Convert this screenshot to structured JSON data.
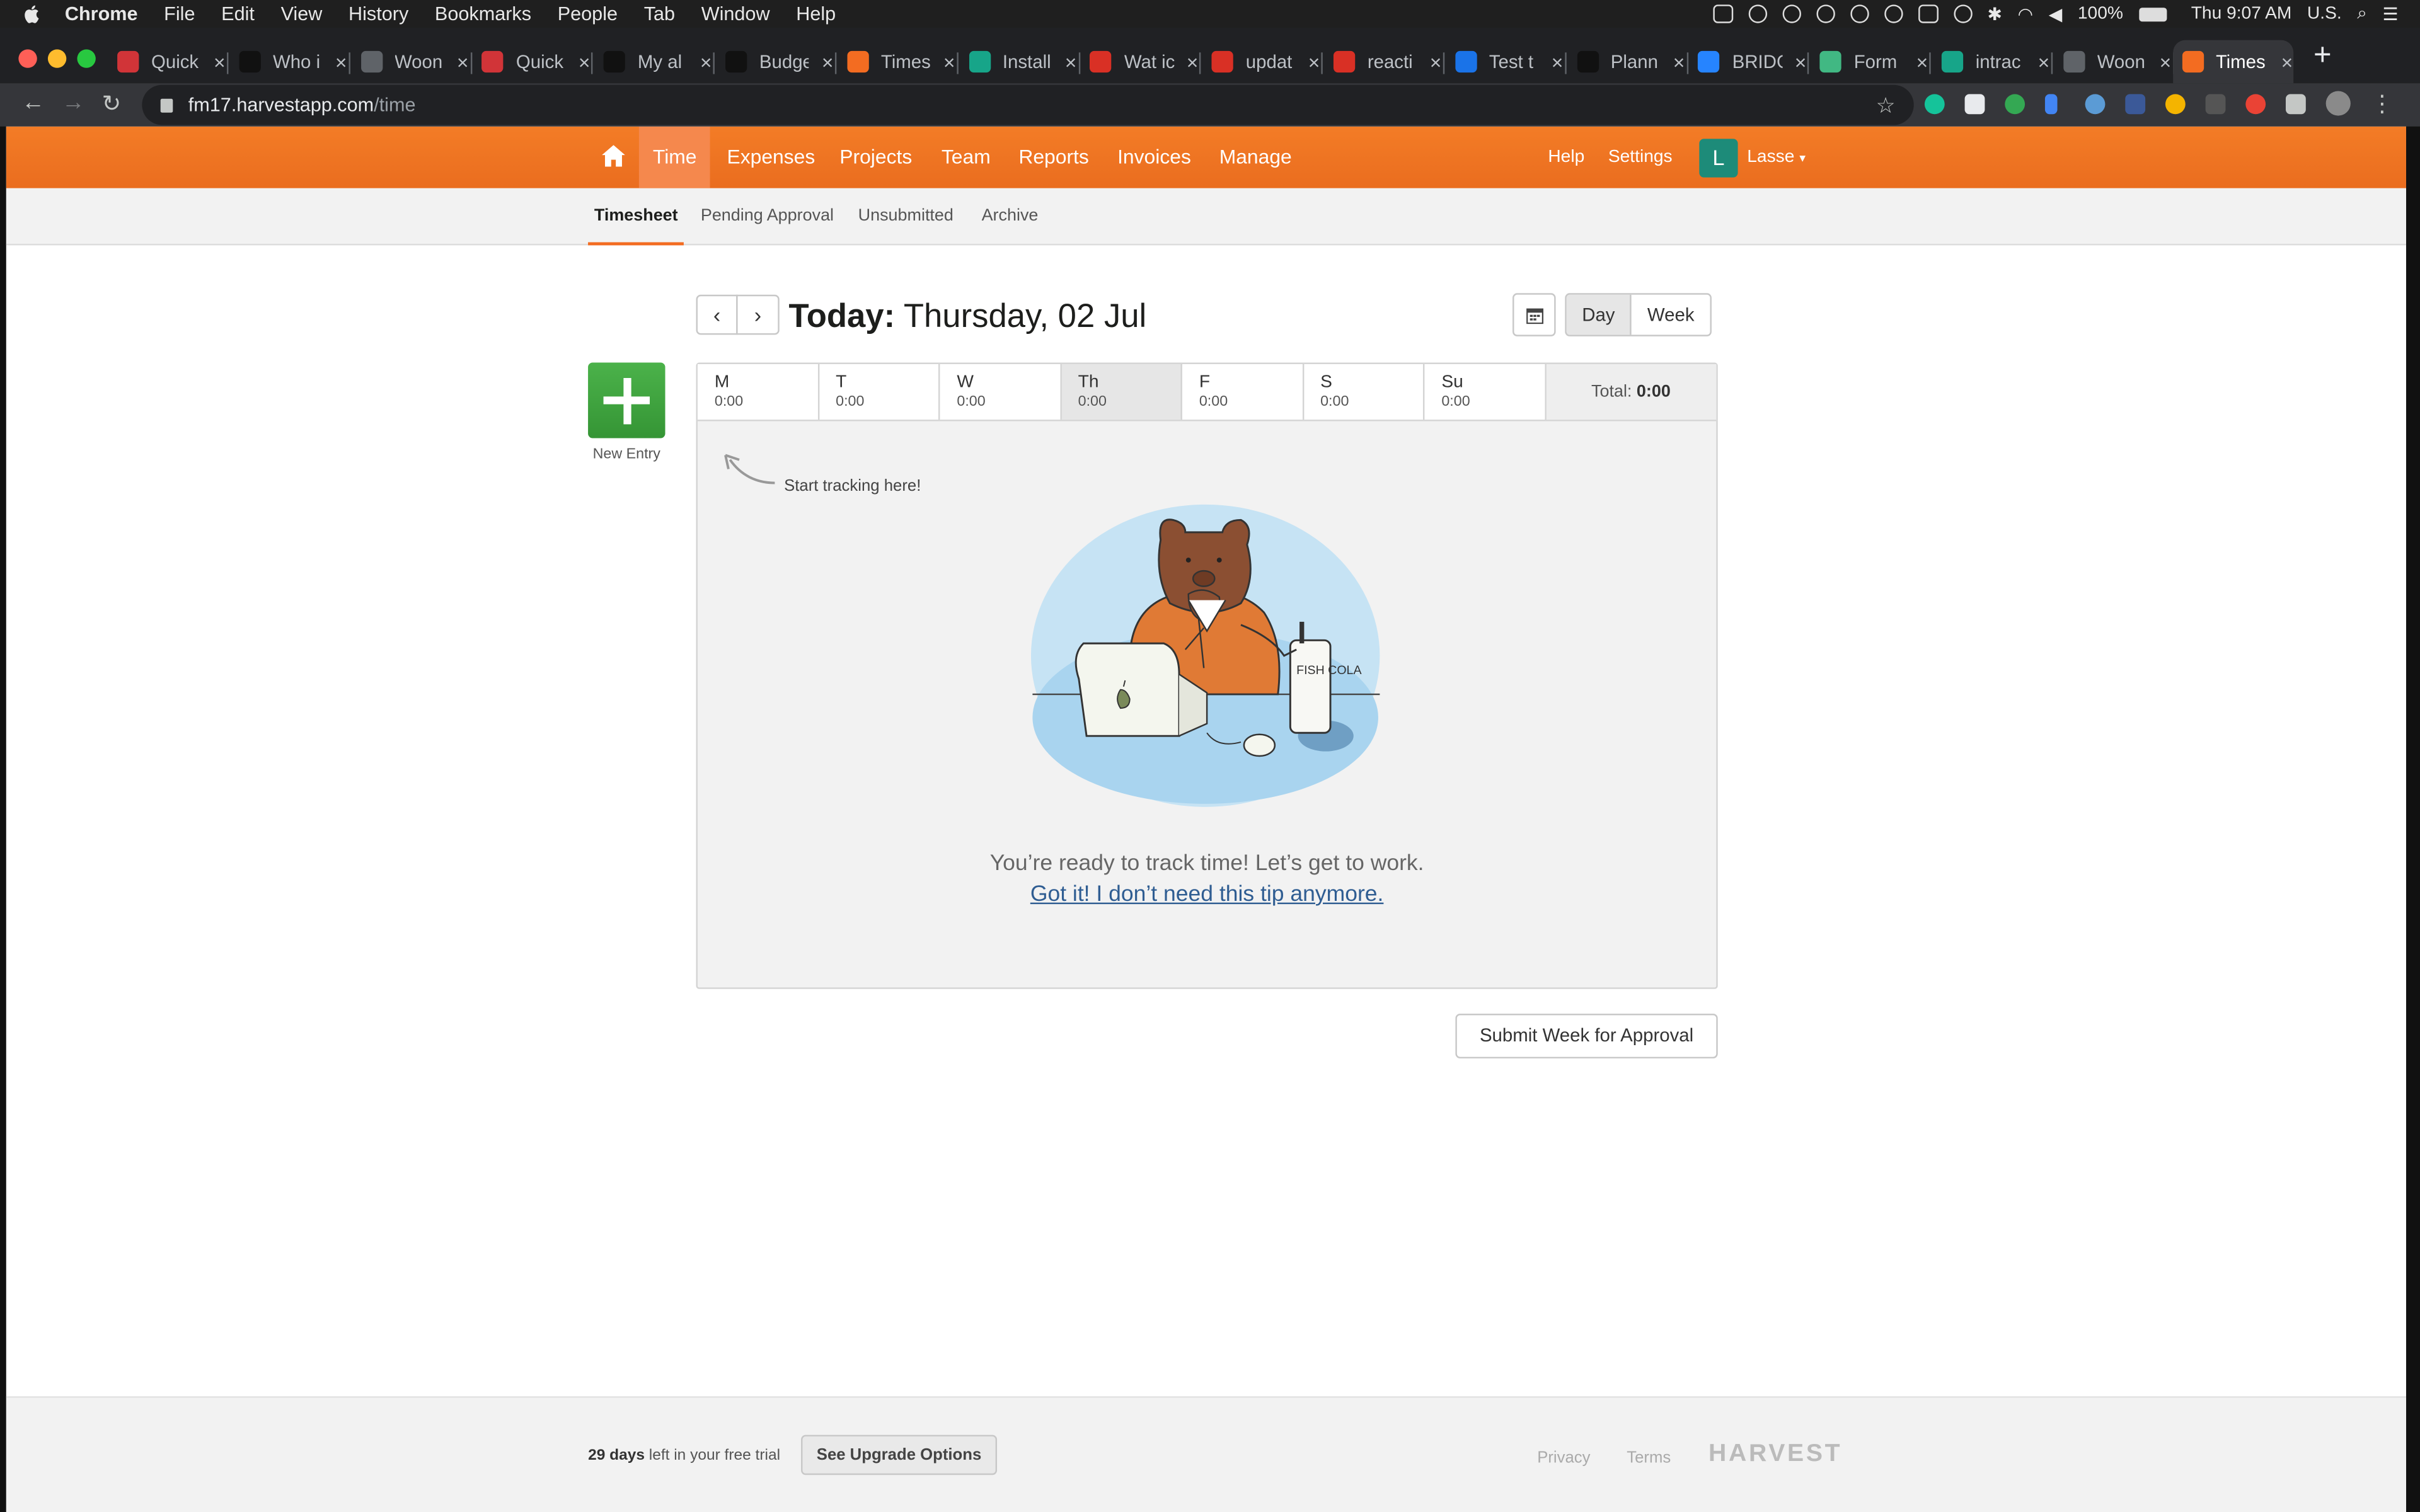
{
  "menubar": {
    "app": "Chrome",
    "items": [
      "File",
      "Edit",
      "View",
      "History",
      "Bookmarks",
      "People",
      "Tab",
      "Window",
      "Help"
    ],
    "battery": "100%",
    "clock": "Thu 9:07 AM",
    "input_source": "U.S."
  },
  "tabs": [
    {
      "title": "Quick",
      "favicon_color": "#d13438"
    },
    {
      "title": "Who i",
      "favicon_color": "#111111"
    },
    {
      "title": "Woon",
      "favicon_color": "#5f6368"
    },
    {
      "title": "Quick",
      "favicon_color": "#d13438"
    },
    {
      "title": "My al",
      "favicon_color": "#111111"
    },
    {
      "title": "Budge",
      "favicon_color": "#111111"
    },
    {
      "title": "Times",
      "favicon_color": "#f36c21"
    },
    {
      "title": "Install",
      "favicon_color": "#17a589"
    },
    {
      "title": "Wat ic",
      "favicon_color": "#d93025"
    },
    {
      "title": "updat",
      "favicon_color": "#d93025"
    },
    {
      "title": "reacti",
      "favicon_color": "#d93025"
    },
    {
      "title": "Test t",
      "favicon_color": "#1a73e8"
    },
    {
      "title": "Plann",
      "favicon_color": "#111111"
    },
    {
      "title": "BRIDG",
      "favicon_color": "#2684ff"
    },
    {
      "title": "Form",
      "favicon_color": "#41b883"
    },
    {
      "title": "intrac",
      "favicon_color": "#17a589"
    },
    {
      "title": "Woon",
      "favicon_color": "#5f6368"
    },
    {
      "title": "Times",
      "favicon_color": "#f36c21",
      "active": true
    }
  ],
  "omnibox": {
    "host": "fm17.harvestapp.com",
    "path": "/time"
  },
  "nav": {
    "items": [
      "Time",
      "Expenses",
      "Projects",
      "Team",
      "Reports",
      "Invoices",
      "Manage"
    ],
    "active": "Time",
    "help": "Help",
    "settings": "Settings",
    "avatar_letter": "L",
    "user": "Lasse",
    "brand_color": "#f36c21"
  },
  "subnav": {
    "items": [
      "Timesheet",
      "Pending Approval",
      "Unsubmitted",
      "Archive"
    ],
    "active": "Timesheet"
  },
  "header": {
    "today_label": "Today:",
    "date": "Thursday, 02 Jul",
    "view_day": "Day",
    "view_week": "Week",
    "active_view": "Day"
  },
  "new_entry": {
    "label": "New Entry"
  },
  "week": {
    "days": [
      {
        "name": "M",
        "time": "0:00"
      },
      {
        "name": "T",
        "time": "0:00"
      },
      {
        "name": "W",
        "time": "0:00"
      },
      {
        "name": "Th",
        "time": "0:00",
        "selected": true
      },
      {
        "name": "F",
        "time": "0:00"
      },
      {
        "name": "S",
        "time": "0:00"
      },
      {
        "name": "Su",
        "time": "0:00"
      }
    ],
    "total_label": "Total:",
    "total_value": "0:00"
  },
  "empty_state": {
    "hint": "Start tracking here!",
    "message": "You’re ready to track time! Let’s get to work.",
    "dismiss_link": "Got it! I don’t need this tip anymore.",
    "can_label": "FISH COLA"
  },
  "submit_button": "Submit Week for Approval",
  "footer": {
    "days_left": "29 days",
    "trial_text": "left in your free trial",
    "upgrade_button": "See Upgrade Options",
    "privacy": "Privacy",
    "terms": "Terms",
    "logo": "HARVEST"
  }
}
